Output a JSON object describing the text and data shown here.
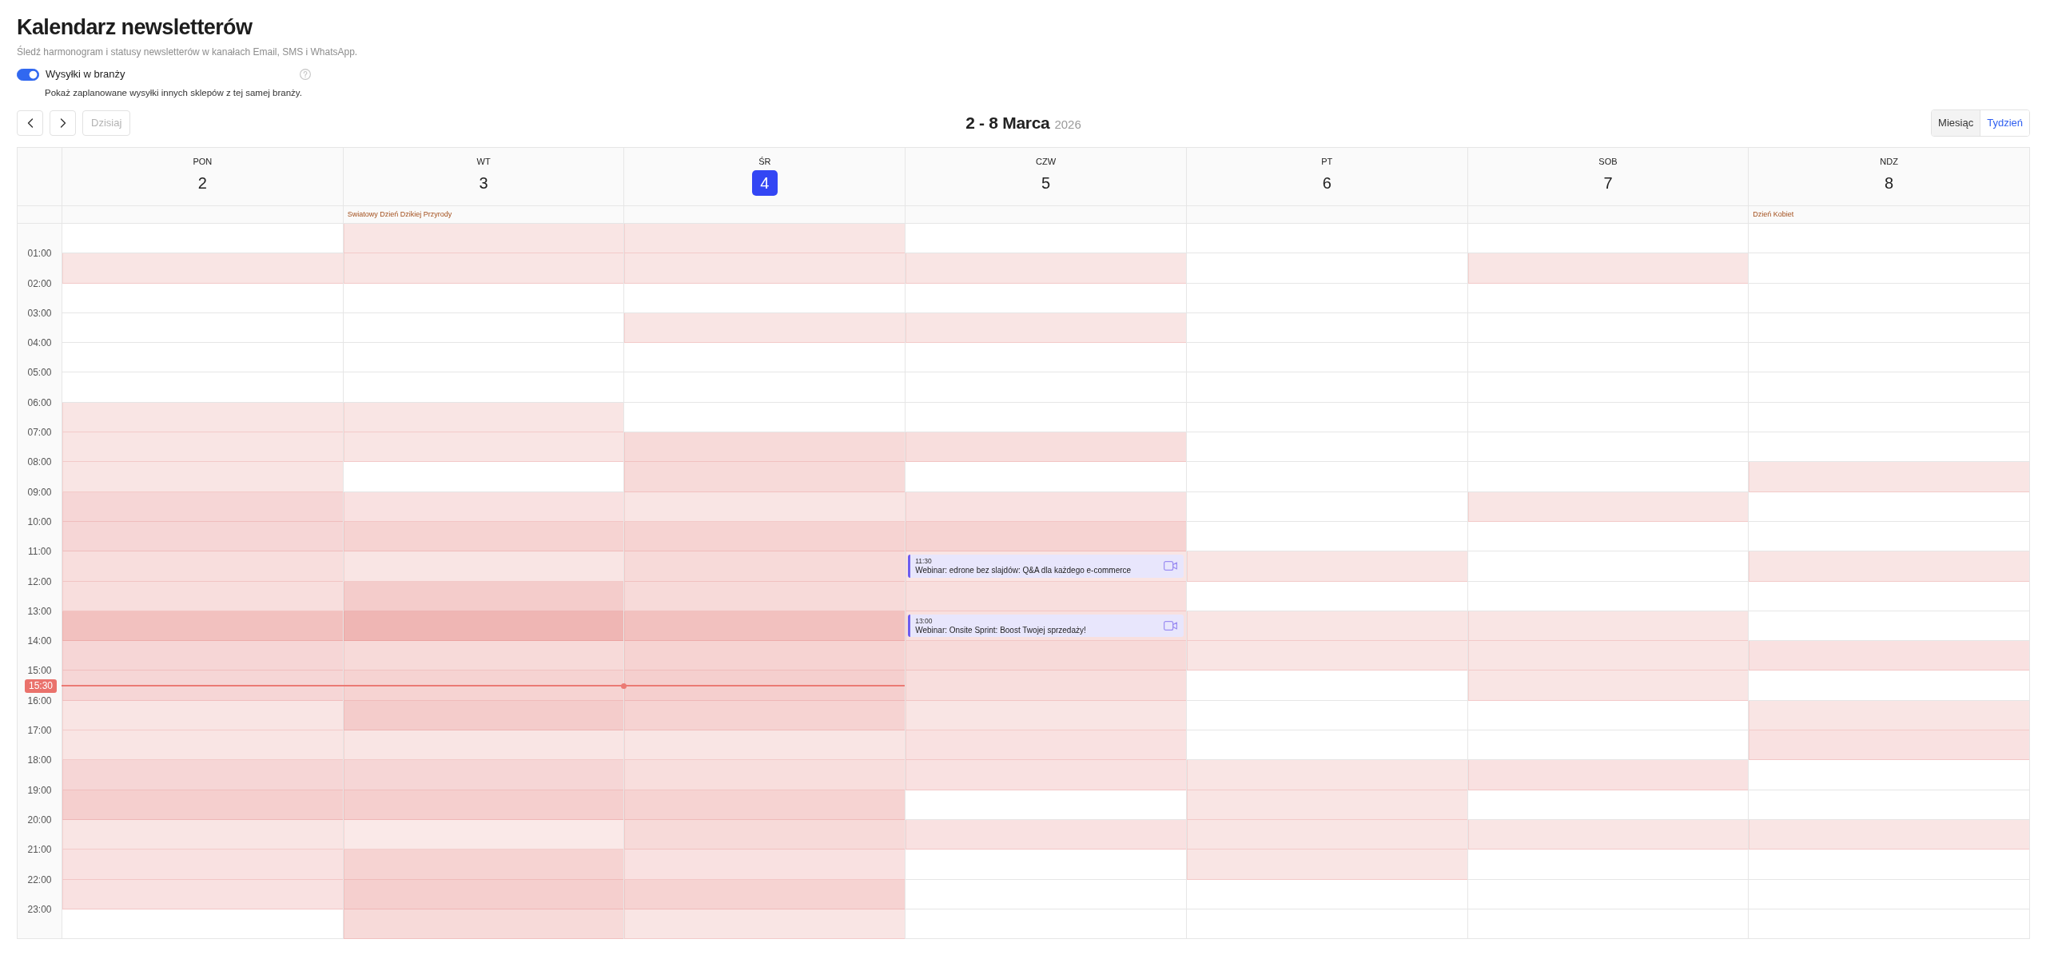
{
  "header": {
    "title": "Kalendarz newsletterów",
    "subtitle": "Śledź harmonogram i statusy newsletterów w kanałach Email, SMS i WhatsApp."
  },
  "industry_toggle": {
    "label": "Wysyłki w branży",
    "on": true,
    "description": "Pokaż zaplanowane wysyłki innych sklepów z tej samej branży."
  },
  "toolbar": {
    "today_button": {
      "label": "Dzisiaj",
      "disabled": true
    },
    "range_title": "2 - 8 Marca",
    "year": "2026",
    "views": [
      {
        "label": "Miesiąc",
        "selected": false
      },
      {
        "label": "Tydzień",
        "selected": true
      }
    ]
  },
  "time_labels": [
    "01:00",
    "02:00",
    "03:00",
    "04:00",
    "05:00",
    "06:00",
    "07:00",
    "08:00",
    "09:00",
    "10:00",
    "11:00",
    "12:00",
    "13:00",
    "14:00",
    "15:00",
    "16:00",
    "17:00",
    "18:00",
    "19:00",
    "20:00",
    "21:00",
    "22:00",
    "23:00"
  ],
  "days": [
    {
      "weekday": "PON",
      "date": "2",
      "today": false,
      "slots": [
        {
          "highlighted": false
        },
        {
          "highlighted": true,
          "color": "#f9e5e4"
        },
        {
          "highlighted": false
        },
        {
          "highlighted": false
        },
        {
          "highlighted": false
        },
        {
          "highlighted": false
        },
        {
          "highlighted": true,
          "color": "#f9e5e4"
        },
        {
          "highlighted": true,
          "color": "#f9e5e4"
        },
        {
          "highlighted": true,
          "color": "#f9e5e4"
        },
        {
          "highlighted": true,
          "color": "#f6d6d6"
        },
        {
          "highlighted": true,
          "color": "#f6d6d6"
        },
        {
          "highlighted": true,
          "color": "#f8dedd"
        },
        {
          "highlighted": true,
          "color": "#f8dedd"
        },
        {
          "highlighted": true,
          "color": "#f2c1bf"
        },
        {
          "highlighted": true,
          "color": "#f6d6d6"
        },
        {
          "highlighted": true,
          "color": "#f6d6d6"
        },
        {
          "highlighted": true,
          "color": "#f9e5e4"
        },
        {
          "highlighted": true,
          "color": "#f9e5e4"
        },
        {
          "highlighted": true,
          "color": "#f6d6d6"
        },
        {
          "highlighted": true,
          "color": "#f5cfce"
        },
        {
          "highlighted": true,
          "color": "#f9e5e4"
        },
        {
          "highlighted": true,
          "color": "#f9e1e1"
        },
        {
          "highlighted": true,
          "color": "#f9e1e1"
        },
        {
          "highlighted": false
        }
      ]
    },
    {
      "weekday": "WT",
      "date": "3",
      "today": false,
      "holiday": "Swiatowy Dzień Dzikiej Przyrody",
      "slots": [
        {
          "highlighted": true,
          "color": "#f9e5e4"
        },
        {
          "highlighted": true,
          "color": "#f9e5e4"
        },
        {
          "highlighted": false
        },
        {
          "highlighted": false
        },
        {
          "highlighted": false
        },
        {
          "highlighted": false
        },
        {
          "highlighted": true,
          "color": "#f9e5e4"
        },
        {
          "highlighted": true,
          "color": "#f9e5e4"
        },
        {
          "highlighted": false
        },
        {
          "highlighted": true,
          "color": "#f9e1e1"
        },
        {
          "highlighted": true,
          "color": "#f6d3d2"
        },
        {
          "highlighted": true,
          "color": "#f9e5e4"
        },
        {
          "highlighted": true,
          "color": "#f4cccb"
        },
        {
          "highlighted": true,
          "color": "#efb6b4"
        },
        {
          "highlighted": true,
          "color": "#f7dad9"
        },
        {
          "highlighted": true,
          "color": "#f6d3d2"
        },
        {
          "highlighted": true,
          "color": "#f4cccb"
        },
        {
          "highlighted": true,
          "color": "#f9e5e4"
        },
        {
          "highlighted": true,
          "color": "#f6d6d6"
        },
        {
          "highlighted": true,
          "color": "#f5cfce"
        },
        {
          "highlighted": true,
          "color": "#fae9e8"
        },
        {
          "highlighted": true,
          "color": "#f6d3d2"
        },
        {
          "highlighted": true,
          "color": "#f5cfce"
        },
        {
          "highlighted": true,
          "color": "#f7dad9"
        }
      ]
    },
    {
      "weekday": "ŚR",
      "date": "4",
      "today": true,
      "slots": [
        {
          "highlighted": true,
          "color": "#f9e5e4"
        },
        {
          "highlighted": true,
          "color": "#f9e5e4"
        },
        {
          "highlighted": false
        },
        {
          "highlighted": true,
          "color": "#f9e5e4"
        },
        {
          "highlighted": false
        },
        {
          "highlighted": false
        },
        {
          "highlighted": false
        },
        {
          "highlighted": true,
          "color": "#f7dad9"
        },
        {
          "highlighted": true,
          "color": "#f7dad9"
        },
        {
          "highlighted": true,
          "color": "#f9e5e4"
        },
        {
          "highlighted": true,
          "color": "#f6d3d2"
        },
        {
          "highlighted": true,
          "color": "#f7dad9"
        },
        {
          "highlighted": true,
          "color": "#f7dad9"
        },
        {
          "highlighted": true,
          "color": "#f2c1bf"
        },
        {
          "highlighted": true,
          "color": "#f6d3d2"
        },
        {
          "highlighted": true,
          "color": "#f5cfce",
          "now": "15:30"
        },
        {
          "highlighted": true,
          "color": "#f6d3d2"
        },
        {
          "highlighted": true,
          "color": "#f9e5e4"
        },
        {
          "highlighted": true,
          "color": "#f8dedd"
        },
        {
          "highlighted": true,
          "color": "#f6d3d2"
        },
        {
          "highlighted": true,
          "color": "#f7dad9"
        },
        {
          "highlighted": true,
          "color": "#f9e1e1"
        },
        {
          "highlighted": true,
          "color": "#f6d3d2"
        },
        {
          "highlighted": true,
          "color": "#f9e5e4"
        }
      ]
    },
    {
      "weekday": "CZW",
      "date": "5",
      "today": false,
      "slots": [
        {
          "highlighted": false
        },
        {
          "highlighted": true,
          "color": "#f9e5e4"
        },
        {
          "highlighted": false
        },
        {
          "highlighted": true,
          "color": "#f9e5e4"
        },
        {
          "highlighted": false
        },
        {
          "highlighted": false
        },
        {
          "highlighted": false
        },
        {
          "highlighted": true,
          "color": "#f8dedd"
        },
        {
          "highlighted": false
        },
        {
          "highlighted": true,
          "color": "#f9e1e1"
        },
        {
          "highlighted": true,
          "color": "#f6d3d2"
        },
        {
          "highlighted": true,
          "color": "#f9e5e4",
          "events": [
            {
              "time": "11:30",
              "title": "Webinar: edrone bez slajdów: Q&A dla każdego e-commerce"
            }
          ]
        },
        {
          "highlighted": true,
          "color": "#f8dedd"
        },
        {
          "highlighted": true,
          "events": [
            {
              "time": "13:00",
              "title": "Webinar: Onsite Sprint: Boost Twojej sprzedaży!"
            }
          ]
        },
        {
          "highlighted": true,
          "color": "#f7dad9"
        },
        {
          "highlighted": true,
          "color": "#f8dedd"
        },
        {
          "highlighted": true,
          "color": "#f9e5e4"
        },
        {
          "highlighted": true,
          "color": "#f9e1e1"
        },
        {
          "highlighted": true,
          "color": "#f9e1e1"
        },
        {
          "highlighted": false
        },
        {
          "highlighted": true,
          "color": "#f9e1e1"
        },
        {
          "highlighted": false
        },
        {
          "highlighted": false
        },
        {
          "highlighted": false
        }
      ]
    },
    {
      "weekday": "PT",
      "date": "6",
      "today": false,
      "slots": [
        {
          "highlighted": false
        },
        {
          "highlighted": false
        },
        {
          "highlighted": false
        },
        {
          "highlighted": false
        },
        {
          "highlighted": false
        },
        {
          "highlighted": false
        },
        {
          "highlighted": false
        },
        {
          "highlighted": false
        },
        {
          "highlighted": false
        },
        {
          "highlighted": false
        },
        {
          "highlighted": false
        },
        {
          "highlighted": true,
          "color": "#f9e5e4"
        },
        {
          "highlighted": false
        },
        {
          "highlighted": true,
          "color": "#f9e5e4"
        },
        {
          "highlighted": true,
          "color": "#f9e5e4"
        },
        {
          "highlighted": false
        },
        {
          "highlighted": false
        },
        {
          "highlighted": false
        },
        {
          "highlighted": true,
          "color": "#f9e5e4"
        },
        {
          "highlighted": true,
          "color": "#f9e5e4"
        },
        {
          "highlighted": true,
          "color": "#f9e5e4"
        },
        {
          "highlighted": true,
          "color": "#f9e5e4"
        },
        {
          "highlighted": false
        },
        {
          "highlighted": false
        }
      ]
    },
    {
      "weekday": "SOB",
      "date": "7",
      "today": false,
      "slots": [
        {
          "highlighted": false
        },
        {
          "highlighted": true,
          "color": "#f9e5e4"
        },
        {
          "highlighted": false
        },
        {
          "highlighted": false
        },
        {
          "highlighted": false
        },
        {
          "highlighted": false
        },
        {
          "highlighted": false
        },
        {
          "highlighted": false
        },
        {
          "highlighted": false
        },
        {
          "highlighted": true,
          "color": "#f9e5e4"
        },
        {
          "highlighted": false
        },
        {
          "highlighted": false
        },
        {
          "highlighted": false
        },
        {
          "highlighted": true,
          "color": "#f9e5e4"
        },
        {
          "highlighted": true,
          "color": "#f9e5e4"
        },
        {
          "highlighted": true,
          "color": "#f9e5e4"
        },
        {
          "highlighted": false
        },
        {
          "highlighted": false
        },
        {
          "highlighted": true,
          "color": "#f9e1e1"
        },
        {
          "highlighted": false
        },
        {
          "highlighted": true,
          "color": "#f9e5e4"
        },
        {
          "highlighted": false
        },
        {
          "highlighted": false
        },
        {
          "highlighted": false
        }
      ]
    },
    {
      "weekday": "NDZ",
      "date": "8",
      "today": false,
      "holiday": "Dzień Kobiet",
      "slots": [
        {
          "highlighted": false
        },
        {
          "highlighted": false
        },
        {
          "highlighted": false
        },
        {
          "highlighted": false
        },
        {
          "highlighted": false
        },
        {
          "highlighted": false
        },
        {
          "highlighted": false
        },
        {
          "highlighted": false
        },
        {
          "highlighted": true,
          "color": "#f9e5e4"
        },
        {
          "highlighted": false
        },
        {
          "highlighted": false
        },
        {
          "highlighted": true,
          "color": "#f9e5e4"
        },
        {
          "highlighted": false
        },
        {
          "highlighted": false
        },
        {
          "highlighted": true,
          "color": "#f9e1e1"
        },
        {
          "highlighted": false
        },
        {
          "highlighted": true,
          "color": "#f9e5e4"
        },
        {
          "highlighted": true,
          "color": "#f9e1e1"
        },
        {
          "highlighted": false
        },
        {
          "highlighted": false
        },
        {
          "highlighted": true,
          "color": "#f9e5e4"
        },
        {
          "highlighted": false
        },
        {
          "highlighted": false
        },
        {
          "highlighted": false
        }
      ]
    }
  ]
}
